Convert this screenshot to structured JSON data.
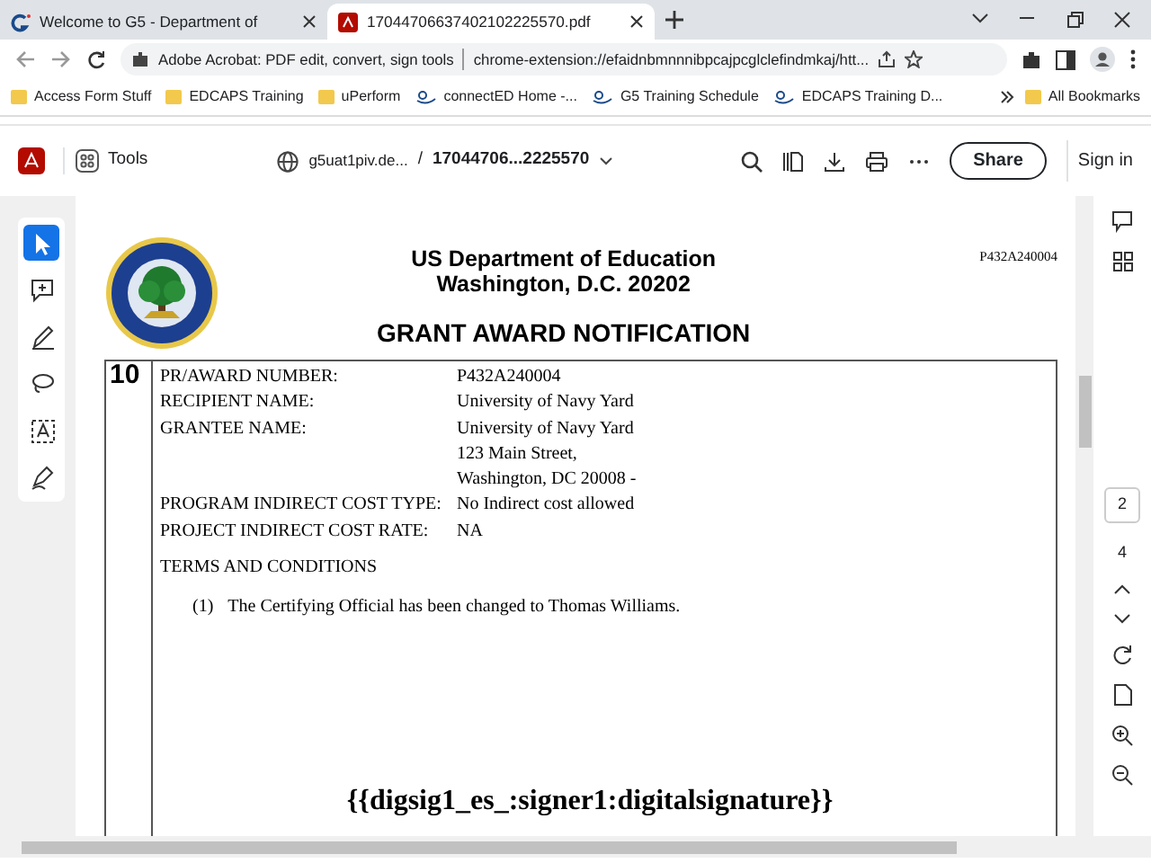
{
  "browser": {
    "tabs": [
      {
        "title": "Welcome to G5 - Department of",
        "selected": false,
        "kind": "g5"
      },
      {
        "title": "17044706637402102225570.pdf",
        "selected": true,
        "kind": "pdf"
      }
    ],
    "address": {
      "site": "Adobe Acrobat: PDF edit, convert, sign tools",
      "url": "chrome-extension://efaidnbmnnnibpcajpcglclefindmkaj/htt..."
    },
    "bookmarks": [
      {
        "label": "Access Form Stuff",
        "kind": "folder"
      },
      {
        "label": "EDCAPS Training",
        "kind": "folder"
      },
      {
        "label": "uPerform",
        "kind": "folder"
      },
      {
        "label": "connectED Home -...",
        "kind": "ced"
      },
      {
        "label": "G5 Training Schedule",
        "kind": "ced"
      },
      {
        "label": "EDCAPS Training D...",
        "kind": "ced"
      }
    ],
    "all_bookmarks": "All Bookmarks"
  },
  "acrobat": {
    "tools": "Tools",
    "path": "g5uat1piv.de...",
    "separator": "/",
    "file": "17044706...2225570",
    "share": "Share",
    "sign_in": "Sign in"
  },
  "left_tools": [
    {
      "kind": "select",
      "selected": true
    },
    {
      "kind": "comment",
      "selected": false
    },
    {
      "kind": "draw",
      "selected": false
    },
    {
      "kind": "lasso",
      "selected": false
    },
    {
      "kind": "text",
      "selected": false
    },
    {
      "kind": "sign",
      "selected": false
    }
  ],
  "page_nav": {
    "current": "2",
    "total": "4"
  },
  "document": {
    "heading": [
      "US Department of Education",
      "Washington, D.C. 20202"
    ],
    "title": "GRANT AWARD NOTIFICATION",
    "ref": "P432A240004",
    "section": "10",
    "fields": [
      {
        "label": "PR/AWARD NUMBER:",
        "values": [
          "P432A240004"
        ]
      },
      {
        "label": "RECIPIENT NAME:",
        "values": [
          "University of Navy Yard"
        ]
      },
      {
        "label": "GRANTEE NAME:",
        "values": [
          "University of Navy Yard",
          "123 Main Street,",
          "Washington, DC 20008 -"
        ]
      },
      {
        "label": "PROGRAM INDIRECT COST TYPE:",
        "values": [
          "No Indirect cost allowed"
        ]
      },
      {
        "label": "PROJECT INDIRECT COST RATE:",
        "values": [
          "NA"
        ]
      }
    ],
    "terms_heading": "TERMS AND CONDITIONS",
    "terms": [
      {
        "number": "(1)",
        "text": "The Certifying Official has been changed to Thomas Williams."
      }
    ],
    "signature": "{{digsig1_es_:signer1:digitalsignature}}"
  }
}
